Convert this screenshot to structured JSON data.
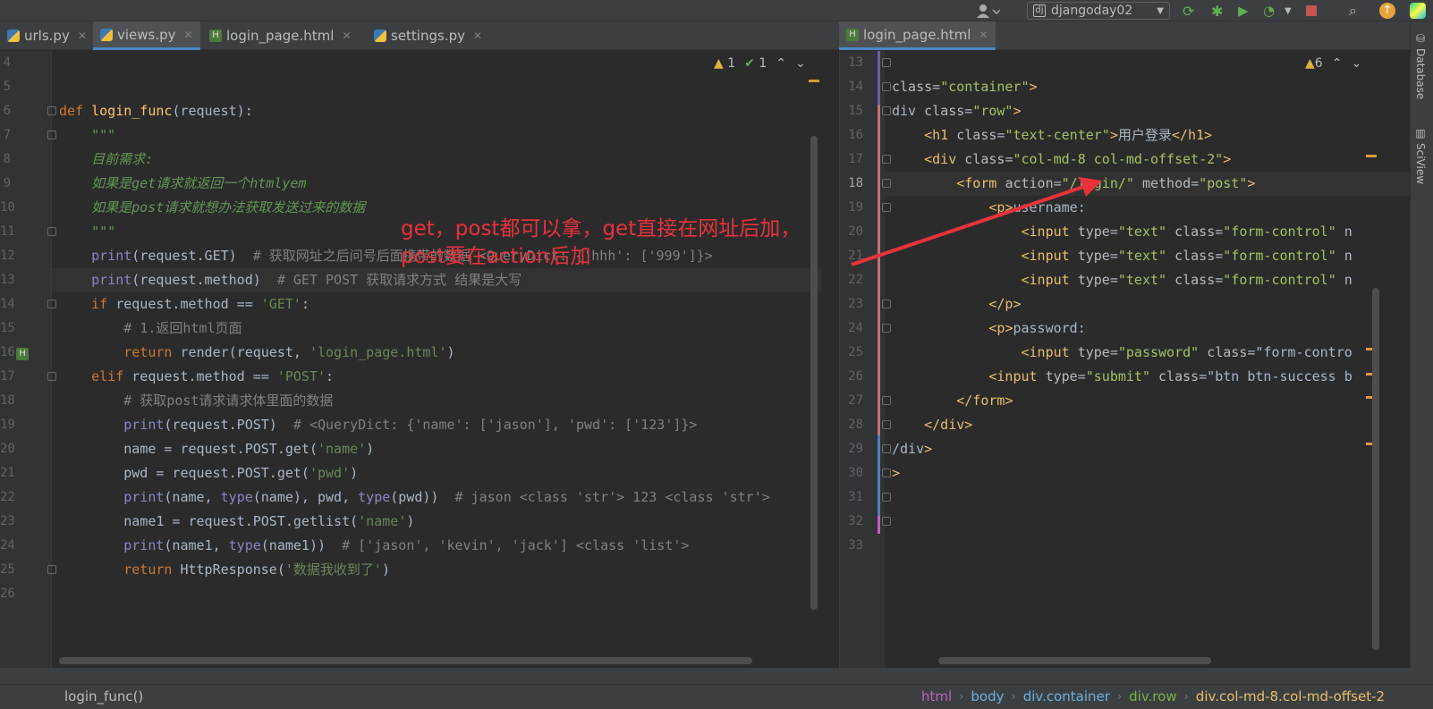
{
  "toolbar": {
    "project": "djangoday02"
  },
  "tabs_left": [
    {
      "label": "urls.py",
      "type": "py",
      "active": false
    },
    {
      "label": "views.py",
      "type": "py",
      "active": true
    },
    {
      "label": "login_page.html",
      "type": "html",
      "active": false
    },
    {
      "label": "settings.py",
      "type": "py",
      "active": false
    }
  ],
  "tabs_right": [
    {
      "label": "login_page.html",
      "type": "html",
      "active": true
    }
  ],
  "left_inspection": {
    "warnings": "1",
    "ok": "1"
  },
  "right_inspection": {
    "warnings": "6"
  },
  "left_lines": [
    {
      "n": "4",
      "code": ""
    },
    {
      "n": "5",
      "code": ""
    },
    {
      "n": "6",
      "code": "def login_func(request):"
    },
    {
      "n": "7",
      "code": "    \"\"\""
    },
    {
      "n": "8",
      "code": "    目前需求:"
    },
    {
      "n": "9",
      "code": "    如果是get请求就返回一个htmlyem"
    },
    {
      "n": "10",
      "code": "    如果是post请求就想办法获取发送过来的数据"
    },
    {
      "n": "11",
      "code": "    \"\"\""
    },
    {
      "n": "12",
      "code": "    print(request.GET)  # 获取网址之后问号后面携带的数据 <QueryDict: {'hhh': ['999']}>"
    },
    {
      "n": "13",
      "code": "    print(request.method)  # GET POST 获取请求方式 结果是大写"
    },
    {
      "n": "14",
      "code": "    if request.method == 'GET':"
    },
    {
      "n": "15",
      "code": "        # 1.返回html页面"
    },
    {
      "n": "16",
      "code": "        return render(request, 'login_page.html')"
    },
    {
      "n": "17",
      "code": "    elif request.method == 'POST':"
    },
    {
      "n": "18",
      "code": "        # 获取post请求请求体里面的数据"
    },
    {
      "n": "19",
      "code": "        print(request.POST)  # <QueryDict: {'name': ['jason'], 'pwd': ['123']}>"
    },
    {
      "n": "20",
      "code": "        name = request.POST.get('name')"
    },
    {
      "n": "21",
      "code": "        pwd = request.POST.get('pwd')"
    },
    {
      "n": "22",
      "code": "        print(name, type(name), pwd, type(pwd))  # jason <class 'str'> 123 <class 'str'>"
    },
    {
      "n": "23",
      "code": "        name1 = request.POST.getlist('name')"
    },
    {
      "n": "24",
      "code": "        print(name1, type(name1))  # ['jason', 'kevin', 'jack'] <class 'list'>"
    },
    {
      "n": "25",
      "code": "        return HttpResponse('数据我收到了')"
    },
    {
      "n": "26",
      "code": ""
    }
  ],
  "right_lines": [
    {
      "n": "13",
      "code": ""
    },
    {
      "n": "14",
      "code": "class=\"container\">"
    },
    {
      "n": "15",
      "code": "div class=\"row\">"
    },
    {
      "n": "16",
      "code": "    <h1 class=\"text-center\">用户登录</h1>"
    },
    {
      "n": "17",
      "code": "    <div class=\"col-md-8 col-md-offset-2\">"
    },
    {
      "n": "18",
      "code": "        <form action=\"/login/\" method=\"post\">"
    },
    {
      "n": "19",
      "code": "            <p>username:"
    },
    {
      "n": "20",
      "code": "                <input type=\"text\" class=\"form-control\" n"
    },
    {
      "n": "21",
      "code": "                <input type=\"text\" class=\"form-control\" n"
    },
    {
      "n": "22",
      "code": "                <input type=\"text\" class=\"form-control\" n"
    },
    {
      "n": "23",
      "code": "            </p>"
    },
    {
      "n": "24",
      "code": "            <p>password:"
    },
    {
      "n": "25",
      "code": "                <input type=\"password\" class=\"form-contro"
    },
    {
      "n": "26",
      "code": "            <input type=\"submit\" class=\"btn btn-success b"
    },
    {
      "n": "27",
      "code": "        </form>"
    },
    {
      "n": "28",
      "code": "    </div>"
    },
    {
      "n": "29",
      "code": "/div>"
    },
    {
      "n": "30",
      "code": ">"
    },
    {
      "n": "31",
      "code": ""
    },
    {
      "n": "32",
      "code": ""
    },
    {
      "n": "33",
      "code": ""
    }
  ],
  "annotation": {
    "line1": "get，post都可以拿，get直接在网址后加，",
    "line2": "post要在action后加"
  },
  "status": {
    "function": "login_func()",
    "breadcrumbs": [
      "html",
      "body",
      "div.container",
      "div.row",
      "div.col-md-8.col-md-offset-2"
    ]
  },
  "sidebar": {
    "database": "Database",
    "sciview": "SciView"
  },
  "colors": {
    "annotation": "#e8323c",
    "keyword": "#cc7832",
    "string": "#6a8759",
    "tag": "#e8bf6a",
    "accent": "#4a88c7"
  }
}
